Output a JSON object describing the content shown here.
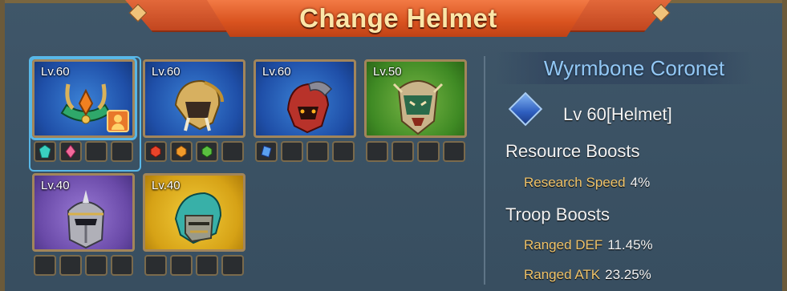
{
  "title": "Change Helmet",
  "helmets": [
    {
      "level": "Lv.60",
      "bg": "#1f4fa8",
      "selected": true,
      "icon": "crown-helmet-icon",
      "gems": [
        "teal-gem-icon",
        "pink-gem-icon",
        "",
        ""
      ],
      "owner_badge": true
    },
    {
      "level": "Lv.60",
      "bg": "#1f4fa8",
      "selected": false,
      "icon": "beast-helmet-icon",
      "gems": [
        "red-gem-icon",
        "orange-gem-icon",
        "green-gem-icon",
        ""
      ]
    },
    {
      "level": "Lv.60",
      "bg": "#1f4fa8",
      "selected": false,
      "icon": "dragon-helmet-icon",
      "gems": [
        "blue-gem-icon",
        "",
        "",
        ""
      ]
    },
    {
      "level": "Lv.50",
      "bg": "#3f8a24",
      "selected": false,
      "icon": "mask-helmet-icon",
      "gems": [
        "",
        "",
        "",
        ""
      ]
    },
    {
      "level": "Lv.40",
      "bg": "#6a4aa8",
      "selected": false,
      "icon": "knight-helmet-icon",
      "gems": [
        "",
        "",
        "",
        ""
      ]
    },
    {
      "level": "Lv.40",
      "bg": "#d6a216",
      "selected": false,
      "icon": "hooded-helmet-icon",
      "gems": [
        "",
        "",
        "",
        ""
      ]
    }
  ],
  "detail": {
    "name": "Wyrmbone Coronet",
    "level_line": "Lv 60[Helmet]",
    "resource_header": "Resource Boosts",
    "resource_stats": [
      {
        "label": "Research Speed",
        "value": "4%"
      }
    ],
    "troop_header": "Troop Boosts",
    "troop_stats": [
      {
        "label": "Ranged DEF",
        "value": "11.45%"
      },
      {
        "label": "Ranged ATK",
        "value": "23.25%"
      }
    ]
  }
}
